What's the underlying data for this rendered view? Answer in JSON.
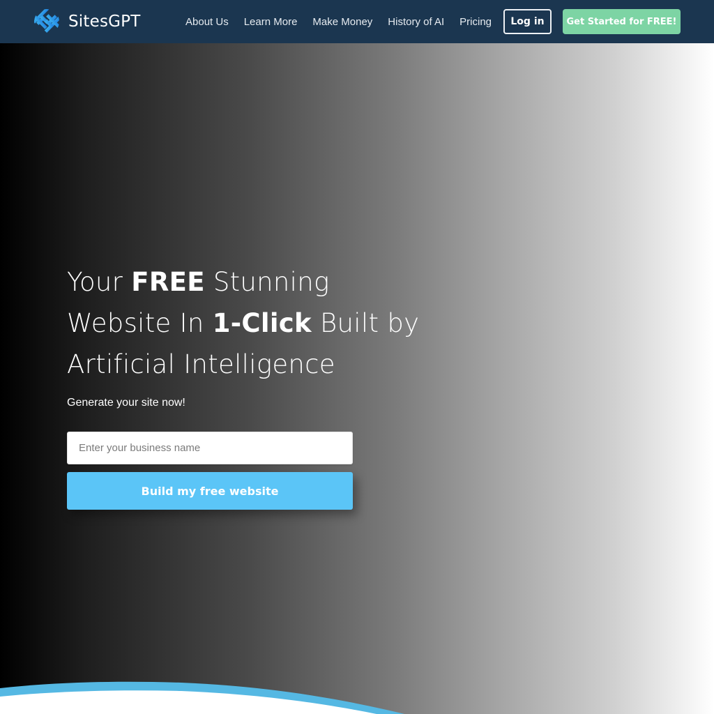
{
  "header": {
    "brand": "SitesGPT",
    "logo_icon": "sitesgpt-woven-logo-icon",
    "nav": [
      {
        "label": "About Us"
      },
      {
        "label": "Learn More"
      },
      {
        "label": "Make Money"
      },
      {
        "label": "History of AI"
      },
      {
        "label": "Pricing"
      }
    ],
    "login_label": "Log in",
    "cta_label": "Get Started for FREE!"
  },
  "hero": {
    "headline": {
      "line1_a": "Your ",
      "line1_b": "FREE",
      "line1_c": " Stunning",
      "line2_a": "Website In ",
      "line2_b": "1-Click",
      "line2_c": " Built by",
      "line3": "Artificial Intelligence"
    },
    "subtext": "Generate your site now!",
    "input": {
      "value": "",
      "placeholder": "Enter your business name"
    },
    "build_button_label": "Build my free website"
  },
  "colors": {
    "header_bg": "#1b3650",
    "cta_green": "#7dd4a4",
    "button_blue": "#5bc5f7",
    "wave_blue": "#55b8e3",
    "logo_blue": "#2d9ce8"
  }
}
